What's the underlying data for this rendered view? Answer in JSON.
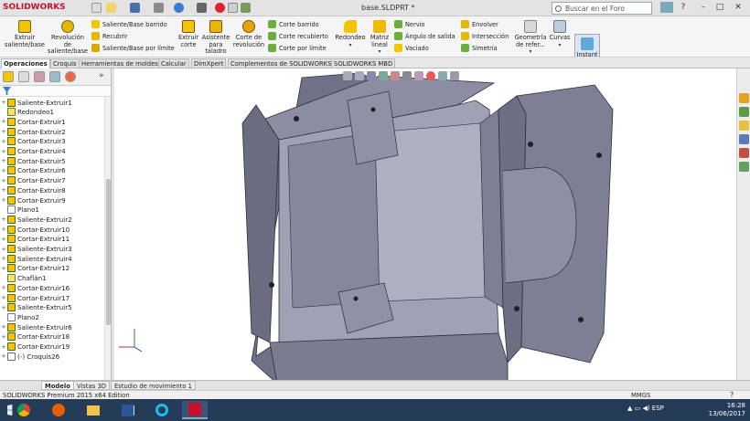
{
  "app": {
    "name": "SOLIDWORKS",
    "document_title": "base.SLDPRT *"
  },
  "search": {
    "placeholder": "Buscar en el Foro"
  },
  "ribbon": {
    "extrude_boss": "Extruir saliente/base",
    "revolve_boss": "Revolución de saliente/base",
    "swept_boss": "Saliente/Base barrido",
    "wrap": "Recubrir",
    "boundary_boss": "Saliente/Base por límite",
    "extrude_cut": "Extruir corte",
    "hole_wizard": "Asistente para taladro",
    "revolve_cut": "Corte de revolución",
    "swept_cut": "Corte barrido",
    "lofted_cut": "Corte recubierto",
    "boundary_cut": "Corte por límite",
    "fillet": "Redondeo",
    "linear_pattern": "Matriz lineal",
    "rib": "Nervio",
    "draft": "Ángulo de salida",
    "shell": "Vaciado",
    "wrap2": "Envolver",
    "intersect": "Intersección",
    "mirror": "Simetría",
    "ref_geometry": "Geometría de refer...",
    "curves": "Curvas",
    "instant3d": "Instant 3D"
  },
  "command_tabs": [
    "Operaciones",
    "Croquis",
    "Herramientas de moldes",
    "Calcular",
    "DimXpert",
    "Complementos de SOLIDWORKS",
    "SOLIDWORKS MBD"
  ],
  "feature_tree": [
    {
      "label": "Saliente-Extruir1",
      "icon": "feature-icon"
    },
    {
      "label": "Redondeo1",
      "icon": "fillet-icon"
    },
    {
      "label": "Cortar-Extruir1",
      "icon": "feature-icon"
    },
    {
      "label": "Cortar-Extruir2",
      "icon": "feature-icon"
    },
    {
      "label": "Cortar-Extruir3",
      "icon": "feature-icon"
    },
    {
      "label": "Cortar-Extruir4",
      "icon": "feature-icon"
    },
    {
      "label": "Cortar-Extruir5",
      "icon": "feature-icon"
    },
    {
      "label": "Cortar-Extruir6",
      "icon": "feature-icon"
    },
    {
      "label": "Cortar-Extruir7",
      "icon": "feature-icon"
    },
    {
      "label": "Cortar-Extruir8",
      "icon": "feature-icon"
    },
    {
      "label": "Cortar-Extruir9",
      "icon": "feature-icon"
    },
    {
      "label": "Plano1",
      "icon": "plane-icon"
    },
    {
      "label": "Saliente-Extruir2",
      "icon": "feature-icon"
    },
    {
      "label": "Cortar-Extruir10",
      "icon": "feature-icon"
    },
    {
      "label": "Cortar-Extruir11",
      "icon": "feature-icon"
    },
    {
      "label": "Saliente-Extruir3",
      "icon": "feature-icon"
    },
    {
      "label": "Saliente-Extruir4",
      "icon": "feature-icon"
    },
    {
      "label": "Cortar-Extruir12",
      "icon": "feature-icon"
    },
    {
      "label": "Chaflán1",
      "icon": "chamfer-icon"
    },
    {
      "label": "Cortar-Extruir16",
      "icon": "feature-icon"
    },
    {
      "label": "Cortar-Extruir17",
      "icon": "feature-icon"
    },
    {
      "label": "Saliente-Extruir5",
      "icon": "feature-icon"
    },
    {
      "label": "Plano2",
      "icon": "plane-icon"
    },
    {
      "label": "Saliente-Extruir6",
      "icon": "feature-icon"
    },
    {
      "label": "Cortar-Extruir18",
      "icon": "feature-icon"
    },
    {
      "label": "Cortar-Extruir19",
      "icon": "feature-icon"
    },
    {
      "label": "(-) Croquis26",
      "icon": "sketch-icon"
    }
  ],
  "bottom_tabs": [
    "Modelo",
    "Vistas 3D",
    "Estudio de movimiento 1"
  ],
  "status": {
    "edition": "SOLIDWORKS Premium 2015 x64 Edition",
    "units": "MMGS"
  },
  "taskbar": {
    "language": "ESP",
    "time": "16:28",
    "date": "13/06/2017"
  },
  "colors": {
    "brand": "#c8102e",
    "model_face": "#7d7f94",
    "model_light": "#9a9cb0",
    "model_dark": "#5b5d70",
    "taskbar": "#243c58"
  }
}
